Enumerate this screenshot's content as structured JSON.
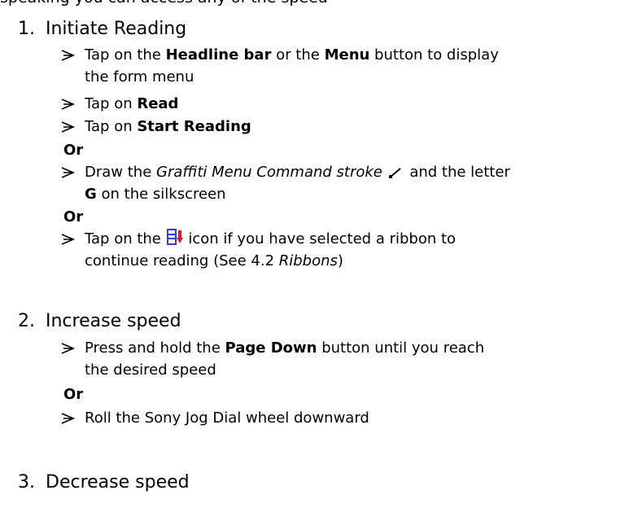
{
  "clipped_top_line": "speaking you can access any of the speed",
  "sections": [
    {
      "num": "1.",
      "title": "Initiate Reading"
    },
    {
      "num": "2.",
      "title": "Increase speed"
    },
    {
      "num": "3.",
      "title": "Decrease speed"
    }
  ],
  "s1": {
    "b1": {
      "t1": "Tap on the ",
      "bold1": "Headline bar",
      "t2": " or the ",
      "bold2": "Menu",
      "t3": " button to display",
      "line2": "the form menu"
    },
    "b2": {
      "t1": "Tap on ",
      "bold1": "Read"
    },
    "b3": {
      "t1": "Tap on ",
      "bold1": "Start Reading"
    },
    "or1": "Or",
    "b4": {
      "t1": "Draw the ",
      "ital1": "Graffiti Menu Command stroke",
      "t2": " and the letter",
      "bold_line2": "G",
      "t3": " on the silkscreen"
    },
    "or2": "Or",
    "b5": {
      "t1": "Tap on the ",
      "t2": " icon if you have selected a ribbon to",
      "line2_t1": "continue reading (See 4.2 ",
      "line2_ital": "Ribbons",
      "line2_t2": ")"
    }
  },
  "s2": {
    "b1": {
      "t1": "Press and hold the ",
      "bold1": "Page Down",
      "t2": " button until you reach",
      "line2": "the desired speed"
    },
    "or1": "Or",
    "b2": {
      "t1": "Roll the Sony Jog Dial wheel downward"
    }
  },
  "icons": {
    "arrow": "arrowhead-bullet-icon",
    "stroke": "graffiti-stroke-icon",
    "reading": "start-reading-icon",
    "reading_color_blue": "#2b3ee0",
    "reading_color_red": "#e01b1b"
  }
}
